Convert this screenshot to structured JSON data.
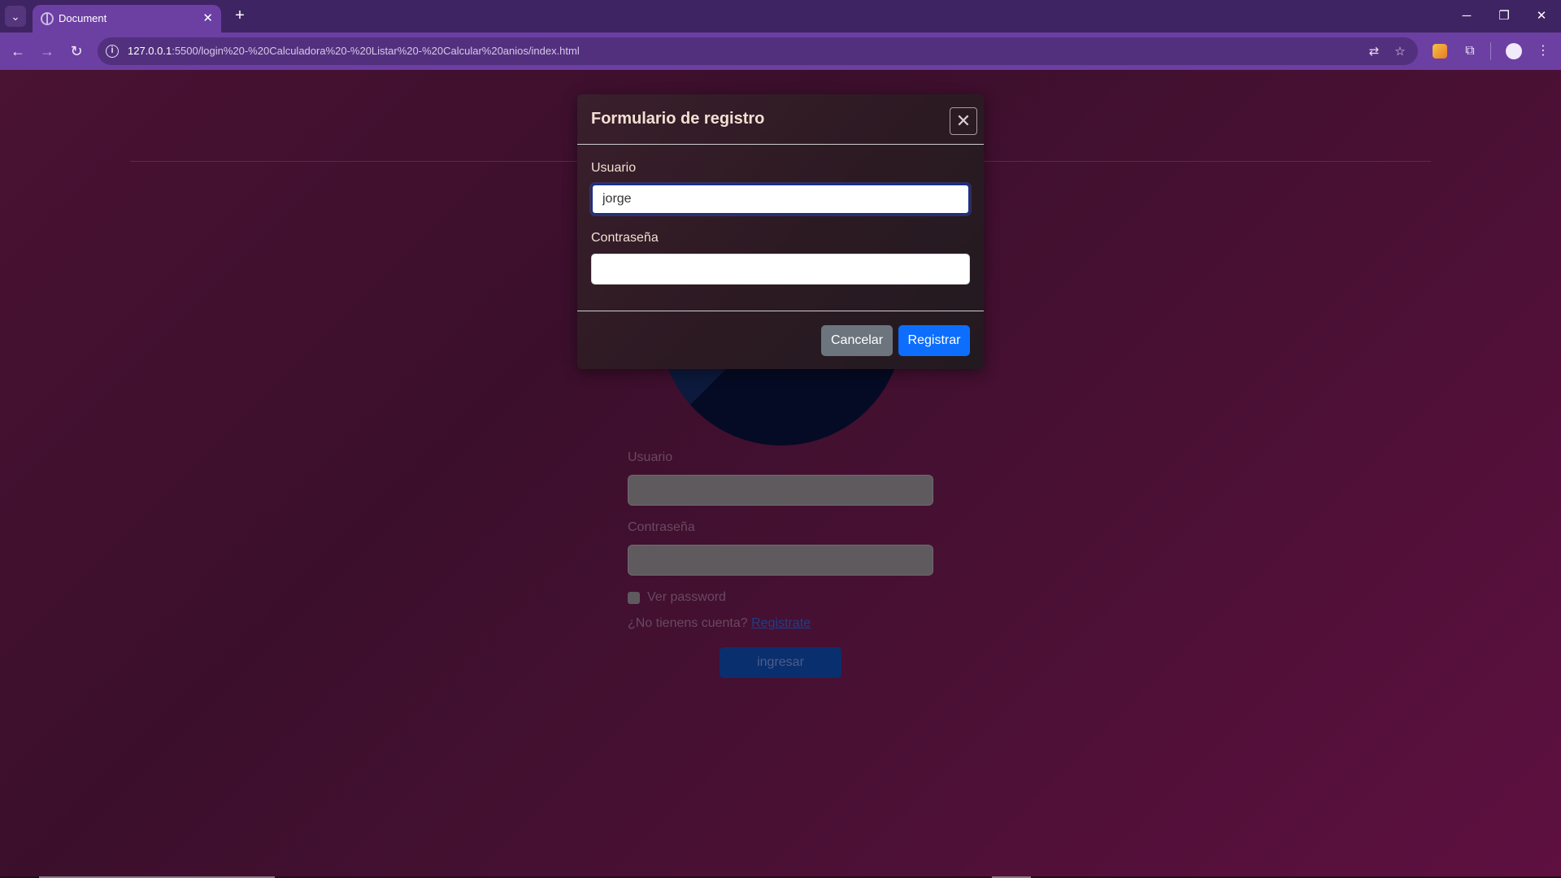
{
  "browser": {
    "tab_title": "Document",
    "url_host": "127.0.0.1",
    "url_rest": ":5500/login%20-%20Calculadora%20-%20Listar%20-%20Calcular%20anios/index.html",
    "icons": {
      "tab_search": "⌄",
      "tab_close": "✕",
      "new_tab": "+",
      "minimize": "─",
      "restore": "❐",
      "close": "✕",
      "back": "←",
      "forward": "→",
      "reload": "↻",
      "info": "i",
      "translate": "⇄",
      "bookmark": "☆",
      "extensions": "⧉",
      "menu": "⋮"
    }
  },
  "page": {
    "user_label": "Usuario",
    "password_label": "Contraseña",
    "show_password_label": "Ver password",
    "no_account_text": "¿No tienens cuenta?",
    "register_link": "Registrate",
    "login_button": "ingresar"
  },
  "modal": {
    "title": "Formulario de registro",
    "close_icon": "✕",
    "user_label": "Usuario",
    "user_value": "jorge",
    "password_label": "Contraseña",
    "password_value": "",
    "cancel_label": "Cancelar",
    "register_label": "Registrar"
  }
}
